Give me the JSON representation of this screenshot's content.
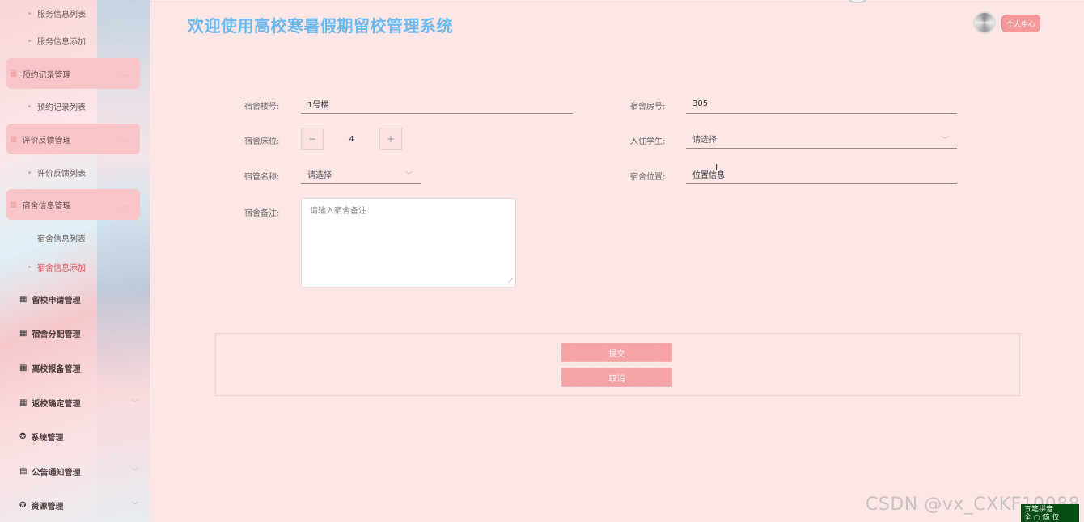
{
  "header": {
    "title": "欢迎使用高校寒暑假期留校管理系统",
    "profile_label": "个人中心"
  },
  "sidebar": {
    "items": [
      {
        "type": "sub",
        "label": "服务信息列表"
      },
      {
        "type": "sub",
        "label": "服务信息添加"
      },
      {
        "type": "group",
        "label": "预约记录管理"
      },
      {
        "type": "sub",
        "label": "预约记录列表"
      },
      {
        "type": "group",
        "label": "评价反馈管理"
      },
      {
        "type": "sub",
        "label": "评价反馈列表"
      },
      {
        "type": "group",
        "label": "宿舍信息管理"
      },
      {
        "type": "sub",
        "label": "宿舍信息列表"
      },
      {
        "type": "sub",
        "label": "宿舍信息添加",
        "active": true
      },
      {
        "type": "top",
        "label": "留校申请管理"
      },
      {
        "type": "top",
        "label": "宿舍分配管理"
      },
      {
        "type": "top",
        "label": "离校报备管理"
      },
      {
        "type": "top",
        "label": "返校确定管理"
      },
      {
        "type": "top",
        "label": "系统管理"
      },
      {
        "type": "top",
        "label": "公告通知管理"
      },
      {
        "type": "top",
        "label": "资源管理"
      }
    ]
  },
  "form": {
    "building_label": "宿舍楼号:",
    "building_value": "1号楼",
    "room_label": "宿舍房号:",
    "room_value": "305",
    "bed_label": "宿舍床位:",
    "bed_value": "4",
    "student_label": "入住学生:",
    "student_value": "请选择",
    "manager_label": "宿管名称:",
    "manager_value": "请选择",
    "location_label": "宿舍位置:",
    "location_value": "位置信息",
    "remark_label": "宿舍备注:",
    "remark_placeholder": "请输入宿舍备注",
    "submit_label": "提交",
    "cancel_label": "取消"
  },
  "watermark": "CSDN @vx_CXKF10088",
  "ime": {
    "line1": "五笔拼音",
    "line2": "全 ○ 简 仅"
  },
  "colors": {
    "accent": "#f5a3a5",
    "title": "#6cb9f0",
    "background": "#fde6e6"
  },
  "icons": {
    "stepper_minus": "minus-icon",
    "stepper_plus": "plus-icon",
    "select_chevron": "chevron-down-icon",
    "menu_grid": "grid-icon"
  }
}
